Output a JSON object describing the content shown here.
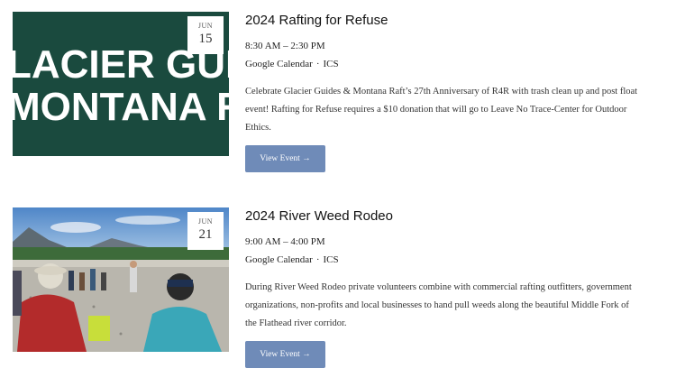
{
  "events": [
    {
      "month": "JUN",
      "day": "15",
      "title": "2024 Rafting for Refuse",
      "time": "8:30 AM – 2:30 PM",
      "google_calendar": "Google Calendar",
      "separator": "·",
      "ics": "ICS",
      "description": "Celebrate Glacier Guides & Montana Raft’s 27th Anniversary of R4R with trash clean up and post float event! Rafting for Refuse requires a $10 donation that will go to Leave No Trace-Center for Outdoor Ethics.",
      "button_label": "View Event →",
      "image": {
        "logo_line1": "LACIER GUIDES",
        "logo_line2": "MONTANA RA"
      }
    },
    {
      "month": "JUN",
      "day": "21",
      "title": "2024 River Weed Rodeo",
      "time": "9:00 AM – 4:00 PM",
      "google_calendar": "Google Calendar",
      "separator": "·",
      "ics": "ICS",
      "description": "During River Weed Rodeo private volunteers combine with commercial rafting outfitters, government organizations, non-profits and local businesses to hand pull weeds along the beautiful Middle Fork of the Flathead river corridor.",
      "button_label": "View Event →"
    }
  ],
  "colors": {
    "logo_bg": "#1a4a3e",
    "button_bg": "#6f8bb8"
  }
}
